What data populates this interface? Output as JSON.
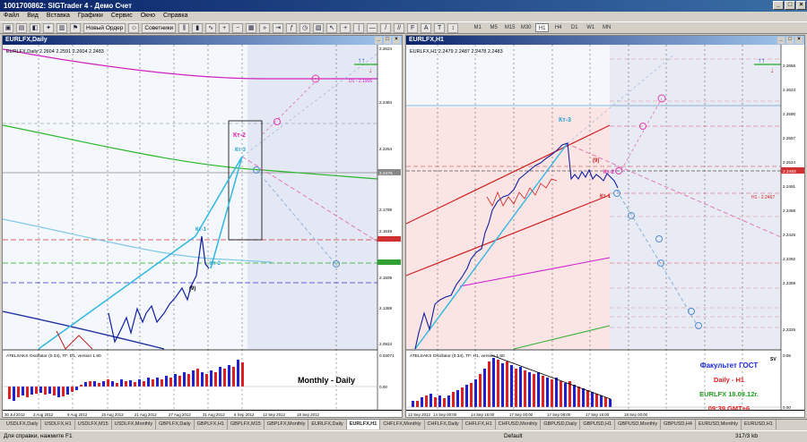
{
  "window": {
    "title": "1001700862: SIGTrader 4 - Демо Счет"
  },
  "menu": [
    "Файл",
    "Вид",
    "Вставка",
    "Графики",
    "Сервис",
    "Окно",
    "Справка"
  ],
  "toolbar": {
    "new_order": "Новый Ордер",
    "advisors": "Советники",
    "timeframes": [
      "M1",
      "M5",
      "M15",
      "M30",
      "H1",
      "H4",
      "D1",
      "W1",
      "MN"
    ],
    "active_timeframe": "H1"
  },
  "chart_left": {
    "title": "EURLFX,Daily",
    "info": "EURLFX,Daily 2.2604 2.2591 2.2604 2.2483",
    "price_labels": [
      "2.2624",
      "2.2484",
      "2.2254",
      "2.1799",
      "2.1649",
      "2.1509",
      "2.1369",
      "2.0924"
    ],
    "current_price": "2.2476",
    "date_labels": [
      "30 Jul 2012",
      "3 Aug 2012",
      "9 Aug 2012",
      "15 Aug 2012",
      "21 Aug 2012",
      "27 Aug 2012",
      "31 Aug 2012",
      "6 Sep 2012",
      "12 Sep 2012",
      "18 Sep 2012"
    ],
    "annotations": {
      "kt2": "Кт-2",
      "kt3": "Кт-3",
      "kt1": "Кт-1",
      "kt2b": "Кт-2",
      "nine": "(9)",
      "d1": "D1 - 2.1905"
    },
    "osc_title": "ATELSAKS Oscillator (0.34), TF: D1, version 1.60",
    "osc_scale": [
      "0.03071",
      "0.00",
      "-0.04058"
    ],
    "caption": "Monthly - Daily"
  },
  "chart_right": {
    "title": "EURLFX,H1",
    "info": "EURLFX,H1 2.2479 2.2487 2.2478 2.2483",
    "price_labels": [
      "2.2656",
      "2.2623",
      "2.2590",
      "2.2557",
      "2.2524",
      "2.2491",
      "2.2458",
      "2.2425",
      "2.2392",
      "2.2359",
      "2.2326"
    ],
    "current_price": "2.2483",
    "date_labels": [
      "12 Sep 2012",
      "14 Sep 00:00",
      "14 Sep 16:00",
      "17 Sep 00:00",
      "17 Sep 08:00",
      "17 Sep 16:00",
      "18 Sep 00:00"
    ],
    "annotations": {
      "kt3": "Кт-3",
      "nine": "(9)",
      "kt2": "Кт-2",
      "kt1": "Кт-1",
      "h1": "H1 - 2.2467"
    },
    "osc_title": "ATELSAKS Oscillator (0.34), TF: H1, version 1.60",
    "osc_scale": [
      "0.05",
      "0.00"
    ],
    "info_box": [
      "Факультет ГОСТ",
      "Daily - H1",
      "EURLFX 18.09.12г.",
      "09:39 GMT+6"
    ],
    "sv": "SV"
  },
  "tabs": [
    "USDLFX,Daily",
    "USDLFX,H1",
    "USDLFX,M15",
    "USDLFX,Monthly",
    "GBPLFX,Daily",
    "GBPLFX,H1",
    "GBPLFX,M15",
    "GBPLFX,Monthly",
    "EURLFX,Daily",
    "EURLFX,H1",
    "CHFLFX,Monthly",
    "CHFLFX,Daily",
    "CHFLFX,H1",
    "CHFUSD,Monthly",
    "GBPUSD,Daily",
    "GBPUSD,H1",
    "GBPUSD,Monthly",
    "GBPUSD,H4",
    "EURUSD,Monthly",
    "EURUSD,H1"
  ],
  "active_tab": "EURLFX,H1",
  "status": {
    "help": "Для справки, нажмите F1",
    "profile": "Default",
    "traffic": "317/3 kb"
  }
}
